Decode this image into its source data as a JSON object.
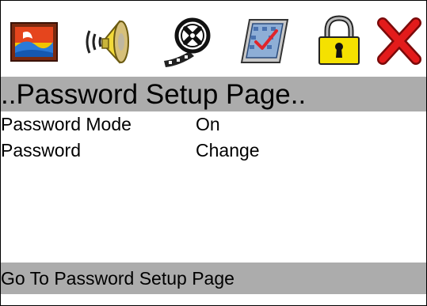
{
  "toolbar": {
    "icons": [
      "picture-icon",
      "speaker-icon",
      "film-reel-icon",
      "tv-setup-icon",
      "padlock-icon",
      "close-icon"
    ]
  },
  "page": {
    "title": "..Password Setup Page.."
  },
  "menu": {
    "items": [
      {
        "label": "Password Mode",
        "value": "On"
      },
      {
        "label": "Password",
        "value": "Change"
      }
    ]
  },
  "status": {
    "text": "Go To Password Setup Page"
  },
  "colors": {
    "bar_background": "#acacac",
    "close_red": "#e31b1b",
    "lock_yellow": "#f5e100",
    "speaker_yellow": "#f2da3a"
  }
}
